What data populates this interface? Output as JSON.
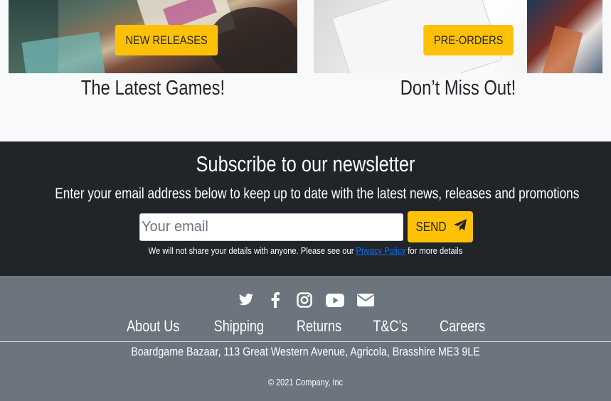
{
  "promos": [
    {
      "badge": "NEW RELEASES",
      "title": "The Latest Games!"
    },
    {
      "badge": "PRE-ORDERS",
      "title": "Don’t Miss Out!"
    }
  ],
  "newsletter": {
    "title": "Subscribe to our newsletter",
    "subtitle": "Enter your email address below to keep up to date with the latest news, releases and promotions",
    "email_placeholder": "Your email",
    "send_label": "SEND",
    "note_before": "We will not share your details with anyone. Please see our ",
    "note_link": "Privacy Policy",
    "note_after": " for more details"
  },
  "footer": {
    "social_icons": [
      "twitter-icon",
      "facebook-icon",
      "instagram-icon",
      "youtube-icon",
      "envelope-icon"
    ],
    "nav": [
      "About Us",
      "Shipping",
      "Returns",
      "T&C’s",
      "Careers"
    ],
    "address": "Boardgame Bazaar, 113 Great Western Avenue, Agricola, Brasshire ME3 9LE",
    "copyright": "© 2021 Company, Inc"
  },
  "colors": {
    "accent": "#ffc107",
    "dark": "#212529",
    "footer": "#6c757d",
    "link": "#0d6efd"
  }
}
